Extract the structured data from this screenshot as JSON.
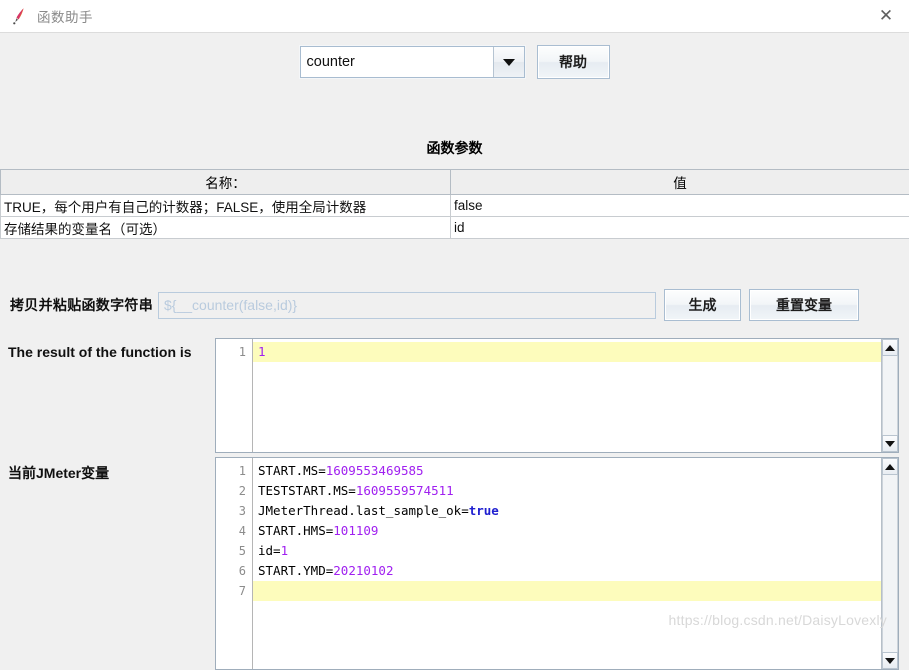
{
  "window": {
    "title": "函数助手",
    "icon": "jmeter-feather-icon",
    "close_label": "✕"
  },
  "toolbar": {
    "function_select_value": "counter",
    "dropdown_icon": "chevron-down-icon",
    "help_label": "帮助"
  },
  "params": {
    "section_title": "函数参数",
    "headers": [
      "名称：",
      "值"
    ],
    "rows": [
      {
        "name": "TRUE，每个用户有自己的计数器；FALSE，使用全局计数器",
        "value": "false"
      },
      {
        "name": "存储结果的变量名（可选）",
        "value": "id"
      }
    ]
  },
  "copy": {
    "label": "拷贝并粘贴函数字符串",
    "field_value": "${__counter(false,id)}",
    "generate_label": "生成",
    "reset_label": "重置变量"
  },
  "result": {
    "label": "The result of the function is",
    "line_numbers": [
      "1"
    ],
    "lines": [
      {
        "text": "1",
        "kind": "num",
        "highlight": true
      }
    ]
  },
  "variables": {
    "label": "当前JMeter变量",
    "line_numbers": [
      "1",
      "2",
      "3",
      "4",
      "5",
      "6",
      "7"
    ],
    "lines": [
      {
        "key": "START.MS=",
        "value": "1609553469585",
        "kind": "num",
        "highlight": false
      },
      {
        "key": "TESTSTART.MS=",
        "value": "1609559574511",
        "kind": "num",
        "highlight": false
      },
      {
        "key": "JMeterThread.last_sample_ok=",
        "value": "true",
        "kind": "bool",
        "highlight": false
      },
      {
        "key": "START.HMS=",
        "value": "101109",
        "kind": "num",
        "highlight": false
      },
      {
        "key": "id=",
        "value": "1",
        "kind": "num",
        "highlight": false
      },
      {
        "key": "START.YMD=",
        "value": "20210102",
        "kind": "num",
        "highlight": false
      },
      {
        "key": "",
        "value": "",
        "kind": "none",
        "highlight": true
      }
    ]
  },
  "watermark": {
    "text": "https://blog.csdn.net/DaisyLovexly"
  },
  "colors": {
    "background": "#f0f0f0",
    "highlight": "#fdfcbc",
    "number": "#a020f0",
    "boolean": "#2020d0",
    "placeholder": "#b9cbde"
  }
}
